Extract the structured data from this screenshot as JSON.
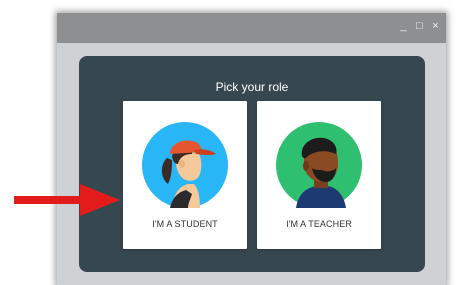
{
  "window": {
    "controls": [
      "_",
      "□",
      "×"
    ]
  },
  "dialog": {
    "title": "Pick your role",
    "cards": [
      {
        "label": "I'M A STUDENT",
        "icon": "student-avatar-icon",
        "bg": "#29b6f6"
      },
      {
        "label": "I'M A TEACHER",
        "icon": "teacher-avatar-icon",
        "bg": "#2fbf71"
      }
    ]
  },
  "colors": {
    "dialog_bg": "#37474f",
    "window_bg": "#cfd2d4",
    "titlebar": "#8d8f91",
    "arrow": "#e31b1b"
  }
}
